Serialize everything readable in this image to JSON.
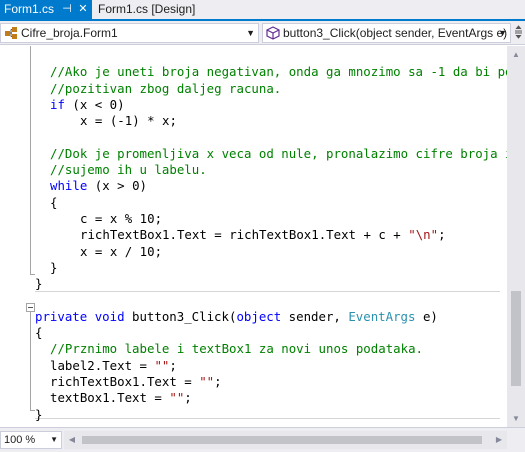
{
  "tabs": [
    {
      "label": "Form1.cs",
      "pin_glyph": "⊣",
      "close_glyph": "✕",
      "active": true
    },
    {
      "label": "Form1.cs [Design]",
      "active": false
    }
  ],
  "navbar": {
    "type_combo": {
      "value": "Cifre_broja.Form1",
      "icon": "class-icon"
    },
    "member_combo": {
      "value": "button3_Click(object sender, EventArgs e)",
      "icon": "method-icon"
    },
    "split_icon": "split-window-icon"
  },
  "editor": {
    "lines": [
      {
        "indent": 2,
        "tokens": [
          {
            "t": "",
            "c": "pl"
          }
        ]
      },
      {
        "indent": 2,
        "tokens": [
          {
            "t": "//Ako je uneti broja negativan, onda ga mnozimo sa -1 da bi poslali pozitivan broj",
            "c": "cm"
          }
        ]
      },
      {
        "indent": 2,
        "tokens": [
          {
            "t": "//pozitivan zbog daljeg racuna.",
            "c": "cm"
          }
        ]
      },
      {
        "indent": 2,
        "tokens": [
          {
            "t": "if",
            "c": "kw"
          },
          {
            "t": " (x < 0)",
            "c": "pl"
          }
        ]
      },
      {
        "indent": 6,
        "tokens": [
          {
            "t": "x = (-1) * x;",
            "c": "pl"
          }
        ]
      },
      {
        "indent": 2,
        "tokens": [
          {
            "t": "",
            "c": "pl"
          }
        ]
      },
      {
        "indent": 2,
        "tokens": [
          {
            "t": "//Dok je promenljiva x veca od nule, pronalazimo cifre broja i",
            "c": "cm"
          }
        ]
      },
      {
        "indent": 2,
        "tokens": [
          {
            "t": "//sujemo ih u labelu.",
            "c": "cm"
          }
        ]
      },
      {
        "indent": 2,
        "tokens": [
          {
            "t": "while",
            "c": "kw"
          },
          {
            "t": " (x > 0)",
            "c": "pl"
          }
        ]
      },
      {
        "indent": 2,
        "tokens": [
          {
            "t": "{",
            "c": "pl"
          }
        ]
      },
      {
        "indent": 6,
        "tokens": [
          {
            "t": "c = x % 10;",
            "c": "pl"
          }
        ]
      },
      {
        "indent": 6,
        "tokens": [
          {
            "t": "richTextBox1.Text = richTextBox1.Text + c + ",
            "c": "pl"
          },
          {
            "t": "\"\\n\"",
            "c": "st"
          },
          {
            "t": ";",
            "c": "pl"
          }
        ]
      },
      {
        "indent": 6,
        "tokens": [
          {
            "t": "x = x / 10;",
            "c": "pl"
          }
        ]
      },
      {
        "indent": 2,
        "tokens": [
          {
            "t": "}",
            "c": "pl"
          }
        ]
      },
      {
        "indent": 0,
        "tokens": [
          {
            "t": "}",
            "c": "pl"
          }
        ]
      },
      {
        "indent": 0,
        "tokens": [
          {
            "t": "",
            "c": "pl"
          }
        ]
      },
      {
        "indent": 0,
        "tokens": [
          {
            "t": "private",
            "c": "kw"
          },
          {
            "t": " ",
            "c": "pl"
          },
          {
            "t": "void",
            "c": "kw"
          },
          {
            "t": " button3_Click(",
            "c": "pl"
          },
          {
            "t": "object",
            "c": "kw"
          },
          {
            "t": " sender, ",
            "c": "pl"
          },
          {
            "t": "EventArgs",
            "c": "ty"
          },
          {
            "t": " e)",
            "c": "pl"
          }
        ]
      },
      {
        "indent": 0,
        "tokens": [
          {
            "t": "{",
            "c": "pl"
          }
        ]
      },
      {
        "indent": 2,
        "tokens": [
          {
            "t": "//Prznimo labele i textBox1 za novi unos podataka.",
            "c": "cm"
          }
        ]
      },
      {
        "indent": 2,
        "tokens": [
          {
            "t": "label2.Text = ",
            "c": "pl"
          },
          {
            "t": "\"\"",
            "c": "st"
          },
          {
            "t": ";",
            "c": "pl"
          }
        ]
      },
      {
        "indent": 2,
        "tokens": [
          {
            "t": "richTextBox1.Text = ",
            "c": "pl"
          },
          {
            "t": "\"\"",
            "c": "st"
          },
          {
            "t": ";",
            "c": "pl"
          }
        ]
      },
      {
        "indent": 2,
        "tokens": [
          {
            "t": "textBox1.Text = ",
            "c": "pl"
          },
          {
            "t": "\"\"",
            "c": "st"
          },
          {
            "t": ";",
            "c": "pl"
          }
        ]
      },
      {
        "indent": 0,
        "tokens": [
          {
            "t": "}",
            "c": "pl"
          }
        ]
      }
    ]
  },
  "statusbar": {
    "zoom": "100 %"
  },
  "colors": {
    "accent": "#007acc",
    "keyword": "#0000ff",
    "comment": "#008000",
    "string": "#a31515",
    "type": "#2b91af"
  }
}
